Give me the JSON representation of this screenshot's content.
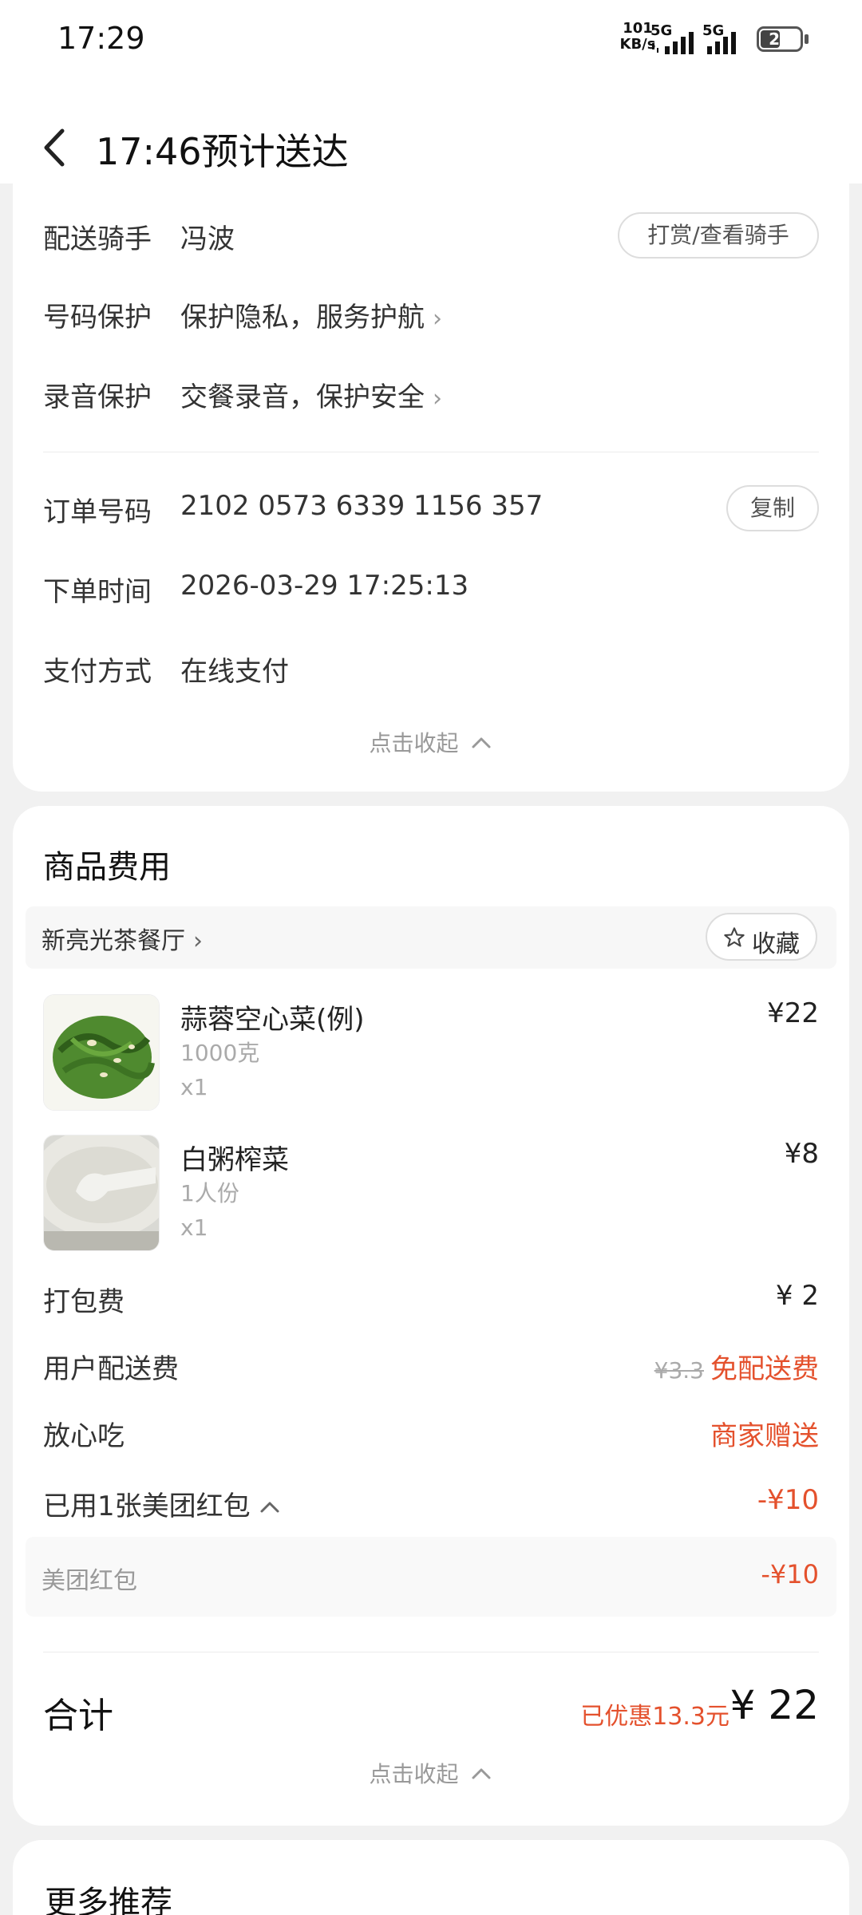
{
  "status_bar": {
    "time": "17:29",
    "net_speed_value": "101",
    "net_speed_unit": "KB/s",
    "sim1_label": "5G",
    "sim2_label": "5G",
    "battery_level": "22"
  },
  "header": {
    "title": "17:46预计送达"
  },
  "delivery": {
    "rider_label": "配送骑手",
    "rider_name": "冯波",
    "rider_button": "打赏/查看骑手",
    "phone_label": "号码保护",
    "phone_value": "保护隐私，服务护航",
    "record_label": "录音保护",
    "record_value": "交餐录音，保护安全"
  },
  "order": {
    "number_label": "订单号码",
    "number_value": "2102 0573 6339 1156 357",
    "copy_button": "复制",
    "time_label": "下单时间",
    "time_value": "2026-03-29 17:25:13",
    "payment_label": "支付方式",
    "payment_value": "在线支付",
    "collapse_label": "点击收起"
  },
  "fees": {
    "section_title": "商品费用",
    "shop_name": "新亮光茶餐厅",
    "favorite_label": "收藏",
    "items": [
      {
        "name": "蒜蓉空心菜(例)",
        "spec": "1000克",
        "qty": "x1",
        "price": "¥22"
      },
      {
        "name": "白粥榨菜",
        "spec": "1人份",
        "qty": "x1",
        "price": "¥8"
      }
    ],
    "packing_label": "打包费",
    "packing_value": "¥ 2",
    "delivery_fee_label": "用户配送费",
    "delivery_fee_original": "¥3.3",
    "delivery_fee_value": "免配送费",
    "assurance_label": "放心吃",
    "assurance_value": "商家赠送",
    "redpacket_label": "已用1张美团红包",
    "redpacket_value": "-¥10",
    "redpacket_detail_label": "美团红包",
    "redpacket_detail_value": "-¥10",
    "total_label": "合计",
    "total_saved": "已优惠13.3元",
    "total_value": "¥ 22",
    "collapse_label": "点击收起"
  },
  "more": {
    "title": "更多推荐"
  },
  "colors": {
    "accent_red": "#e4512d",
    "background": "#f1f1f1"
  }
}
